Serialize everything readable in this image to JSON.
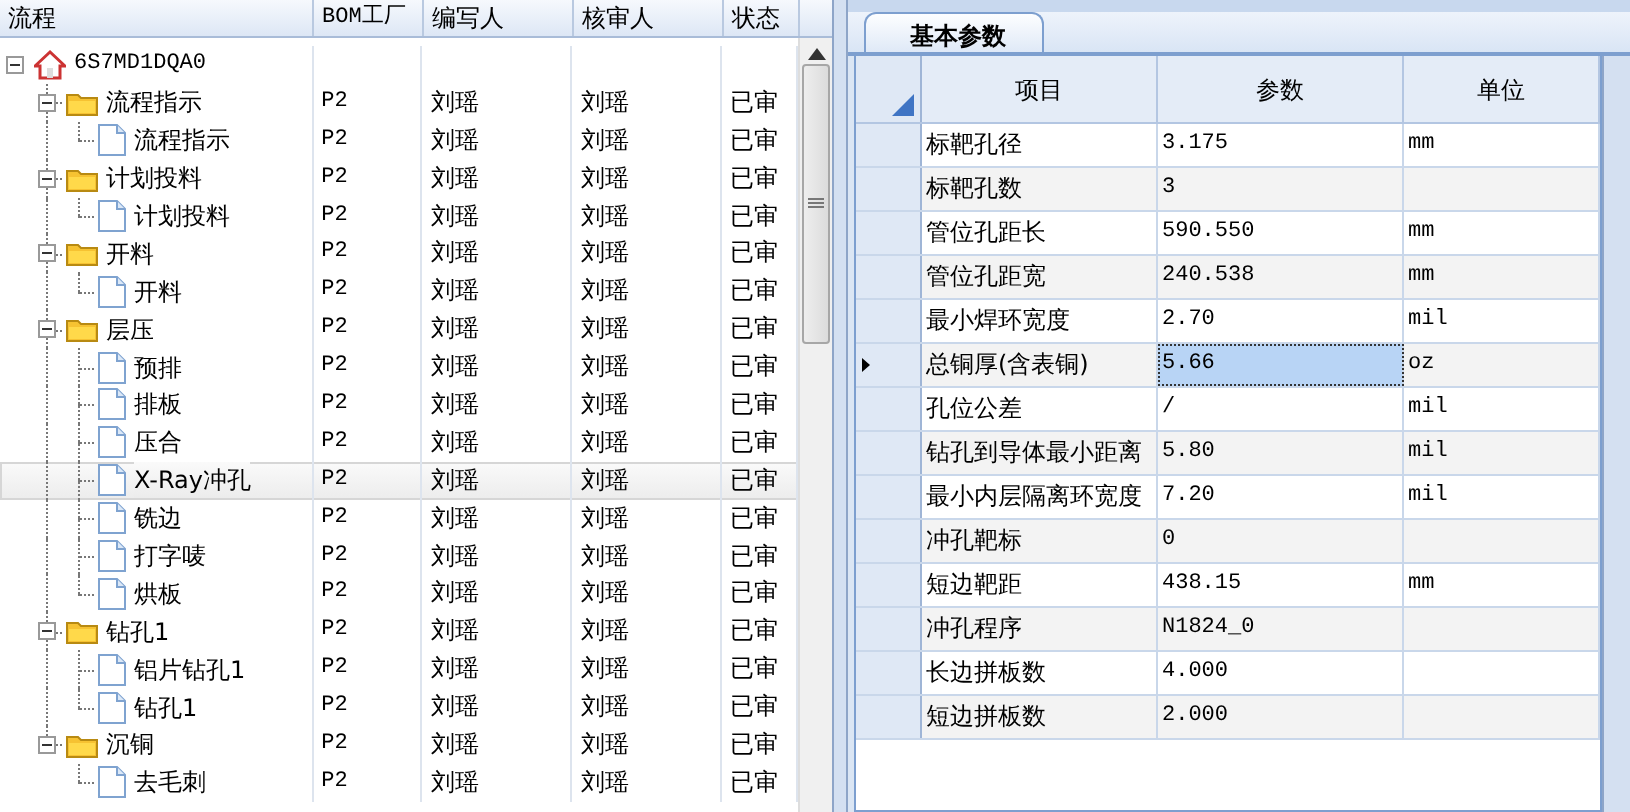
{
  "tree": {
    "columns": [
      "流程",
      "BOM工厂",
      "编写人",
      "核审人",
      "状态"
    ],
    "nodes": [
      {
        "label": "6S7MD1DQA0",
        "kind": "root",
        "expanded": true,
        "children": [
          {
            "label": "流程指示",
            "kind": "folder",
            "expanded": true,
            "cells": [
              "P2",
              "刘瑶",
              "刘瑶",
              "已审"
            ],
            "children": [
              {
                "label": "流程指示",
                "kind": "file",
                "cells": [
                  "P2",
                  "刘瑶",
                  "刘瑶",
                  "已审"
                ],
                "selected": false
              }
            ]
          },
          {
            "label": "计划投料",
            "kind": "folder",
            "expanded": true,
            "cells": [
              "P2",
              "刘瑶",
              "刘瑶",
              "已审"
            ],
            "children": [
              {
                "label": "计划投料",
                "kind": "file",
                "cells": [
                  "P2",
                  "刘瑶",
                  "刘瑶",
                  "已审"
                ],
                "selected": false
              }
            ]
          },
          {
            "label": "开料",
            "kind": "folder",
            "expanded": true,
            "cells": [
              "P2",
              "刘瑶",
              "刘瑶",
              "已审"
            ],
            "children": [
              {
                "label": "开料",
                "kind": "file",
                "cells": [
                  "P2",
                  "刘瑶",
                  "刘瑶",
                  "已审"
                ],
                "selected": false
              }
            ]
          },
          {
            "label": "层压",
            "kind": "folder",
            "expanded": true,
            "cells": [
              "P2",
              "刘瑶",
              "刘瑶",
              "已审"
            ],
            "children": [
              {
                "label": "预排",
                "kind": "file",
                "cells": [
                  "P2",
                  "刘瑶",
                  "刘瑶",
                  "已审"
                ],
                "selected": false
              },
              {
                "label": "排板",
                "kind": "file",
                "cells": [
                  "P2",
                  "刘瑶",
                  "刘瑶",
                  "已审"
                ],
                "selected": false
              },
              {
                "label": "压合",
                "kind": "file",
                "cells": [
                  "P2",
                  "刘瑶",
                  "刘瑶",
                  "已审"
                ],
                "selected": false
              },
              {
                "label": "X-Ray冲孔",
                "kind": "file",
                "cells": [
                  "P2",
                  "刘瑶",
                  "刘瑶",
                  "已审"
                ],
                "selected": true
              },
              {
                "label": "铣边",
                "kind": "file",
                "cells": [
                  "P2",
                  "刘瑶",
                  "刘瑶",
                  "已审"
                ],
                "selected": false
              },
              {
                "label": "打字唛",
                "kind": "file",
                "cells": [
                  "P2",
                  "刘瑶",
                  "刘瑶",
                  "已审"
                ],
                "selected": false
              },
              {
                "label": "烘板",
                "kind": "file",
                "cells": [
                  "P2",
                  "刘瑶",
                  "刘瑶",
                  "已审"
                ],
                "selected": false
              }
            ]
          },
          {
            "label": "钻孔1",
            "kind": "folder",
            "expanded": true,
            "cells": [
              "P2",
              "刘瑶",
              "刘瑶",
              "已审"
            ],
            "children": [
              {
                "label": "铝片钻孔1",
                "kind": "file",
                "cells": [
                  "P2",
                  "刘瑶",
                  "刘瑶",
                  "已审"
                ],
                "selected": false
              },
              {
                "label": "钻孔1",
                "kind": "file",
                "cells": [
                  "P2",
                  "刘瑶",
                  "刘瑶",
                  "已审"
                ],
                "selected": false
              }
            ]
          },
          {
            "label": "沉铜",
            "kind": "folder",
            "expanded": true,
            "cells": [
              "P2",
              "刘瑶",
              "刘瑶",
              "已审"
            ],
            "children": [
              {
                "label": "去毛刺",
                "kind": "file",
                "cells": [
                  "P2",
                  "刘瑶",
                  "刘瑶",
                  "已审"
                ],
                "selected": false
              }
            ]
          }
        ]
      }
    ]
  },
  "tabs": [
    {
      "label": "基本参数",
      "selected": true
    }
  ],
  "grid": {
    "columns": [
      "项目",
      "参数",
      "单位"
    ],
    "rows": [
      {
        "item": "标靶孔径",
        "value": "3.175",
        "unit": "mm",
        "selected": false
      },
      {
        "item": "标靶孔数",
        "value": "3",
        "selected": false
      },
      {
        "item": "管位孔距长",
        "value": "590.550",
        "unit": "mm",
        "selected": false
      },
      {
        "item": "管位孔距宽",
        "value": "240.538",
        "unit": "mm",
        "selected": false
      },
      {
        "item": "最小焊环宽度",
        "value": "2.70",
        "unit": "mil",
        "selected": false
      },
      {
        "item": "总铜厚(含表铜)",
        "value": "5.66",
        "unit": "oz",
        "selected": true
      },
      {
        "item": "孔位公差",
        "value": "/",
        "unit": "mil",
        "selected": false
      },
      {
        "item": "钻孔到导体最小距离",
        "value": "5.80",
        "unit": "mil",
        "selected": false
      },
      {
        "item": "最小内层隔离环宽度",
        "value": "7.20",
        "unit": "mil",
        "selected": false
      },
      {
        "item": "冲孔靶标",
        "value": "0",
        "selected": false
      },
      {
        "item": "短边靶距",
        "value": "438.15",
        "unit": "mm",
        "selected": false
      },
      {
        "item": "冲孔程序",
        "value": "N1824_0",
        "selected": false
      },
      {
        "item": "长边拼板数",
        "value": "4.000",
        "selected": false
      },
      {
        "item": "短边拼板数",
        "value": "2.000",
        "selected": false
      }
    ]
  }
}
